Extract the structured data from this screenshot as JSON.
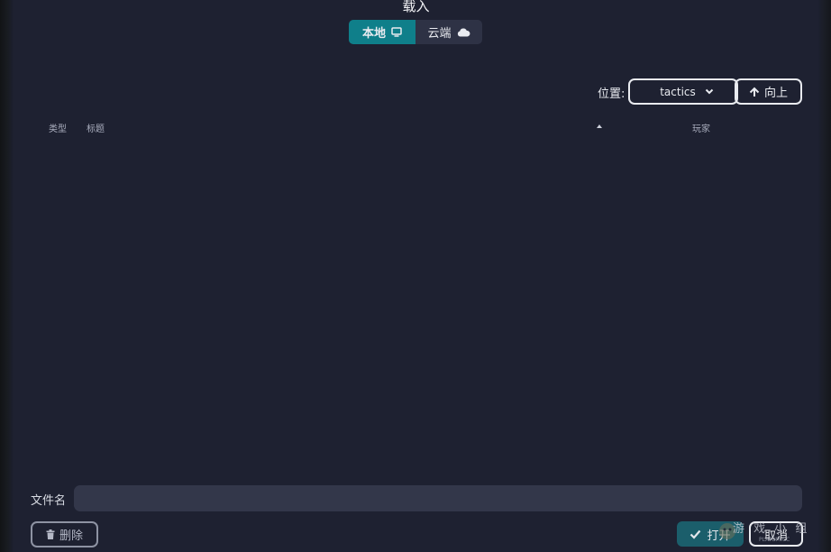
{
  "dialog": {
    "title": "载入",
    "tabs": [
      {
        "label": "本地",
        "icon": "monitor-icon",
        "active": true
      },
      {
        "label": "云端",
        "icon": "cloud-icon",
        "active": false
      }
    ]
  },
  "location": {
    "label": "位置:",
    "value": "tactics",
    "up_label": "向上"
  },
  "table": {
    "columns": [
      "类型",
      "标题",
      "玩家"
    ],
    "sort_column": "标题",
    "rows": []
  },
  "file_name": {
    "label": "文件名",
    "value": ""
  },
  "footer": {
    "delete_label": "删除",
    "open_label": "打开",
    "cancel_label": "取消"
  },
  "watermark": {
    "text": "游 戏 小 组",
    "sub": "PLAYUM.CC"
  },
  "colors": {
    "background": "#1e2131",
    "accent": "#0f7f8a",
    "open_button": "#1b5e6b",
    "input_bg": "#33374a"
  }
}
